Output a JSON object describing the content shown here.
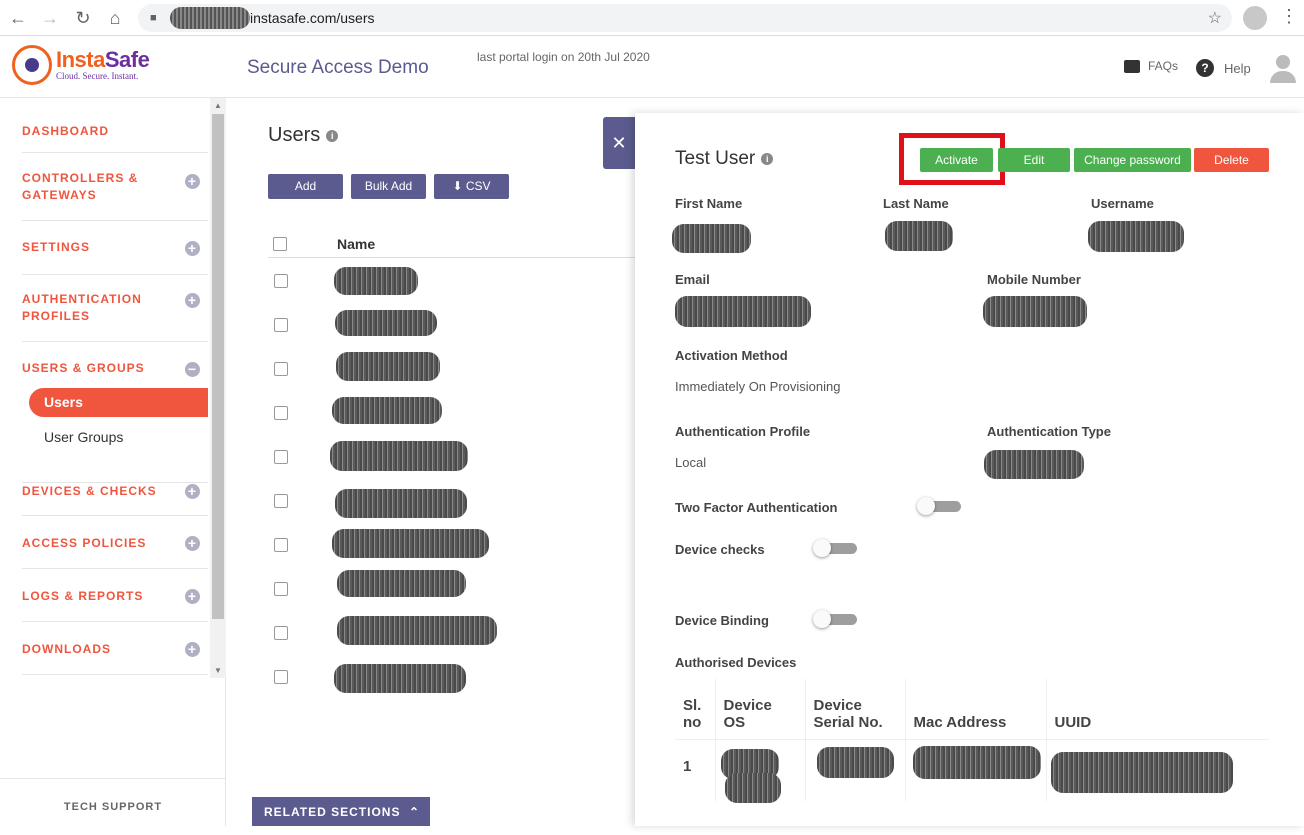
{
  "browser": {
    "url": "instasafe.com/users"
  },
  "header": {
    "logo_name_a": "Insta",
    "logo_name_b": "Safe",
    "logo_tagline": "Cloud. Secure. Instant.",
    "app_title": "Secure Access Demo",
    "last_login": "last portal login on 20th Jul 2020",
    "faqs": "FAQs",
    "help": "Help"
  },
  "sidebar": {
    "items": [
      {
        "label": "DASHBOARD"
      },
      {
        "label": "CONTROLLERS & GATEWAYS"
      },
      {
        "label": "SETTINGS"
      },
      {
        "label": "AUTHENTICATION PROFILES"
      },
      {
        "label": "USERS & GROUPS"
      },
      {
        "label": "DEVICES & CHECKS"
      },
      {
        "label": "ACCESS POLICIES"
      },
      {
        "label": "LOGS & REPORTS"
      },
      {
        "label": "DOWNLOADS"
      }
    ],
    "sub_active": "Users",
    "sub_item": "User Groups",
    "tech_support": "TECH SUPPORT"
  },
  "main": {
    "title": "Users",
    "add": "Add",
    "bulk_add": "Bulk Add",
    "csv": "CSV",
    "name_col": "Name",
    "related": "RELATED SECTIONS"
  },
  "panel": {
    "title": "Test User",
    "activate": "Activate",
    "edit": "Edit",
    "change_password": "Change password",
    "delete": "Delete",
    "first_name": "First Name",
    "last_name": "Last Name",
    "username": "Username",
    "email": "Email",
    "mobile": "Mobile Number",
    "activation_method": "Activation Method",
    "activation_value": "Immediately On Provisioning",
    "auth_profile": "Authentication Profile",
    "auth_profile_value": "Local",
    "auth_type": "Authentication Type",
    "two_factor": "Two Factor Authentication",
    "device_checks": "Device checks",
    "device_binding": "Device Binding",
    "authorised_devices": "Authorised Devices",
    "table": {
      "headers": [
        "Sl. no",
        "Device OS",
        "Device Serial No.",
        "Mac Address",
        "UUID"
      ],
      "rows": [
        [
          "1"
        ]
      ]
    }
  },
  "colors": {
    "accent": "#f0553d",
    "purple": "#5b5b8f",
    "green": "#4caf50",
    "red": "#f0553d",
    "highlight": "#e0101a"
  }
}
